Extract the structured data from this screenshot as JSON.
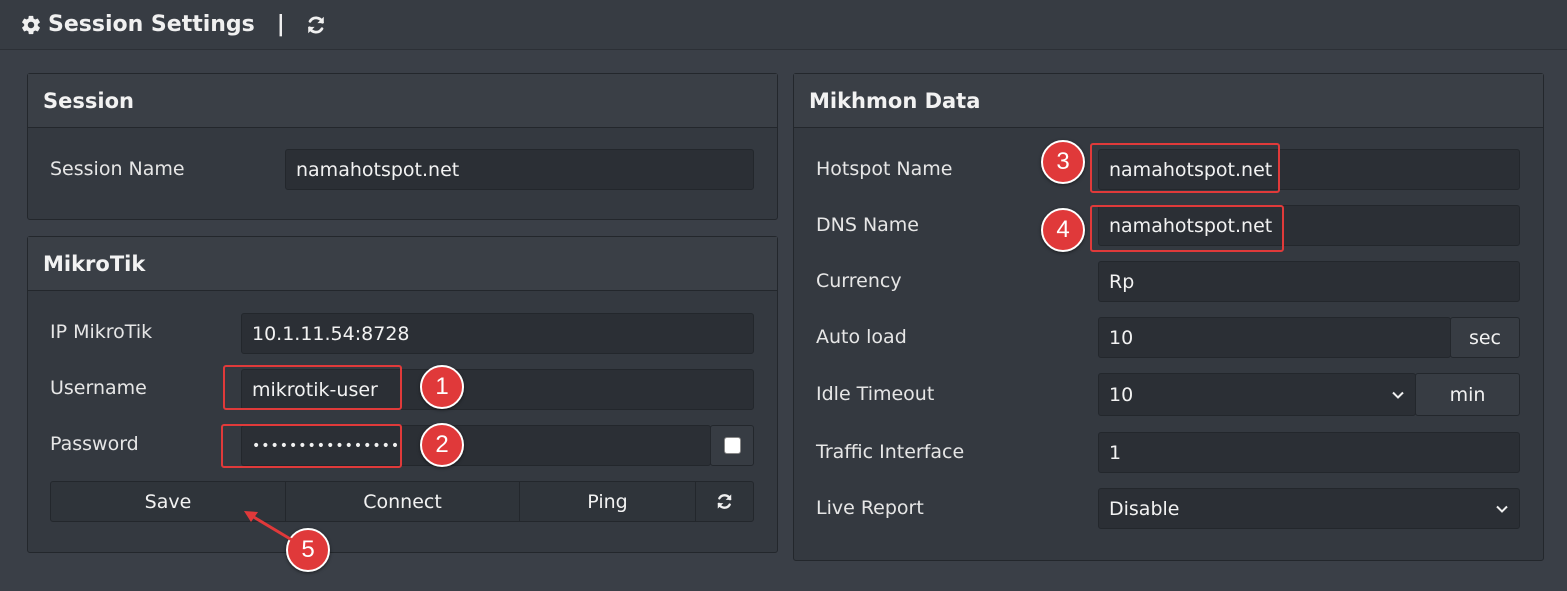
{
  "header": {
    "title": "Session Settings",
    "separator": "|",
    "icons": [
      "gear-icon",
      "refresh-icon"
    ]
  },
  "session_panel": {
    "title": "Session",
    "session_name_label": "Session Name",
    "session_name_value": "namahotspot.net"
  },
  "mikrotik_panel": {
    "title": "MikroTik",
    "ip_label": "IP MikroTik",
    "ip_value": "10.1.11.54:8728",
    "username_label": "Username",
    "username_value": "mikrotik-user",
    "password_label": "Password",
    "password_value": "••••••••••••••••",
    "buttons": {
      "save": "Save",
      "connect": "Connect",
      "ping": "Ping"
    }
  },
  "mikhmon_panel": {
    "title": "Mikhmon Data",
    "hotspot_name_label": "Hotspot Name",
    "hotspot_name_value": "namahotspot.net",
    "dns_name_label": "DNS Name",
    "dns_name_value": "namahotspot.net",
    "currency_label": "Currency",
    "currency_value": "Rp",
    "auto_load_label": "Auto load",
    "auto_load_value": "10",
    "auto_load_unit": "sec",
    "idle_timeout_label": "Idle Timeout",
    "idle_timeout_value": "10",
    "idle_timeout_unit": "min",
    "traffic_interface_label": "Traffic Interface",
    "traffic_interface_value": "1",
    "live_report_label": "Live Report",
    "live_report_value": "Disable"
  },
  "callouts": [
    "1",
    "2",
    "3",
    "4",
    "5"
  ],
  "colors": {
    "callout_red": "#e0393a",
    "background": "#3a3f47"
  }
}
